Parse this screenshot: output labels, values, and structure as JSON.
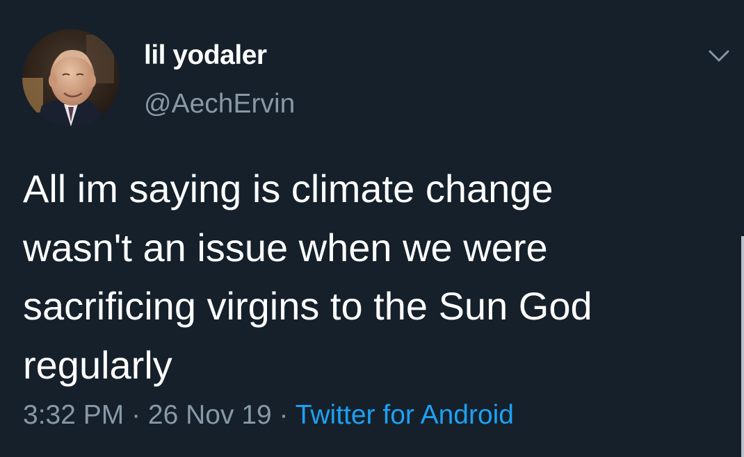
{
  "tweet": {
    "display_name": "lil yodaler",
    "handle": "@AechErvin",
    "text_lines": [
      "All im saying is climate change",
      "wasn't an issue when we were",
      "sacrificing virgins to the Sun God",
      "regularly"
    ],
    "time": "3:32 PM",
    "separator_1": " · ",
    "date": "26 Nov 19",
    "separator_2": " · ",
    "source": "Twitter for Android"
  },
  "icons": {
    "menu": "chevron-down-icon",
    "avatar": "profile-photo"
  },
  "colors": {
    "background": "#15202b",
    "text_primary": "#ffffff",
    "text_secondary": "#8899a6",
    "accent": "#1da1f2"
  }
}
